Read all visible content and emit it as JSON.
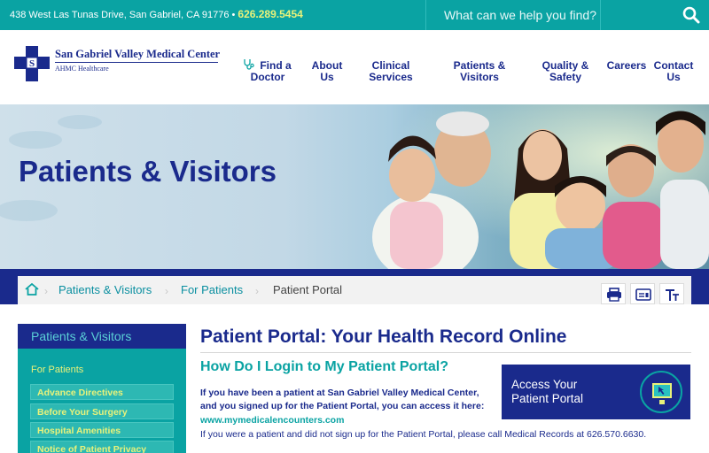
{
  "topbar": {
    "address": "438 West Las Tunas Drive, San Gabriel, CA 91776 • ",
    "phone": "626.289.5454",
    "search_placeholder": "What can we help you find?",
    "search_icon": "search-icon"
  },
  "logo": {
    "name": "San Gabriel Valley Medical Center",
    "subtitle": "AHMC Healthcare",
    "mark": "S"
  },
  "nav": {
    "find_doctor_1": "Find a",
    "find_doctor_2": "Doctor",
    "about_1": "About",
    "about_2": "Us",
    "clinical_1": "Clinical",
    "clinical_2": "Services",
    "patients_1": "Patients &",
    "patients_2": "Visitors",
    "quality_1": "Quality &",
    "quality_2": "Safety",
    "careers": "Careers",
    "contact_1": "Contact",
    "contact_2": "Us"
  },
  "hero": {
    "title": "Patients & Visitors"
  },
  "breadcrumb": {
    "items": [
      "Patients & Visitors",
      "For Patients",
      "Patient Portal"
    ],
    "home_icon": "home-icon"
  },
  "tools": [
    "print-icon",
    "card-icon",
    "text-size-icon"
  ],
  "sidebar": {
    "heading": "Patients & Visitors",
    "category": "For Patients",
    "links": [
      "Advance Directives",
      "Before Your Surgery",
      "Hospital Amenities",
      "Notice of Patient Privacy"
    ]
  },
  "main": {
    "title": "Patient Portal: Your Health Record Online",
    "subhead": "How Do I Login to My Patient Portal?",
    "para1_line1": "If you have been a patient at San Gabriel Valley Medical Center,",
    "para1_line2": "and you signed up for the Patient Portal, you can access it here:",
    "url": "www.mymedicalencounters.com",
    "para2": "If you were a patient and did not sign up for the Patient Portal, please call Medical Records at 626.570.6630."
  },
  "cta": {
    "line1": "Access Your",
    "line2": "Patient Portal",
    "icon": "monitor-icon"
  },
  "colors": {
    "teal": "#0aa3a3",
    "navy": "#1a2a8c",
    "yellow": "#e9f27a"
  }
}
